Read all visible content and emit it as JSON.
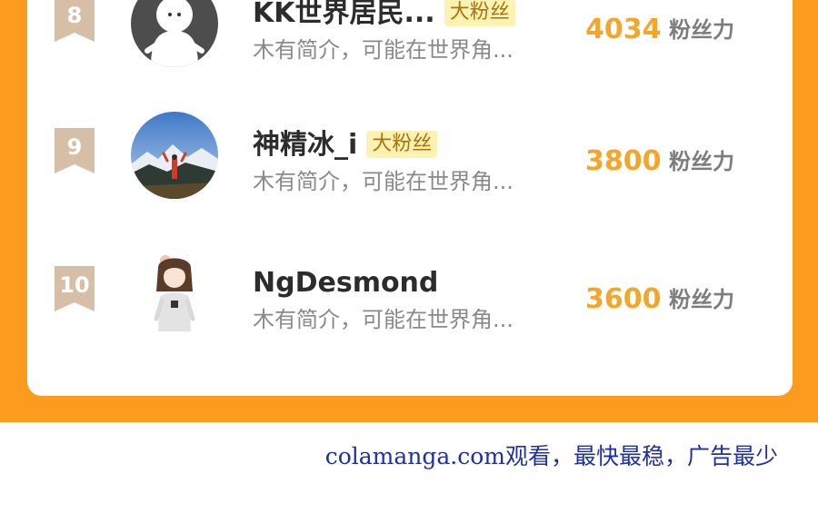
{
  "leaderboard": {
    "rows": [
      {
        "rank": "8",
        "name": "KK世界居民...",
        "badge": "大粉丝",
        "bio": "木有简介，可能在世界角...",
        "score": "4034",
        "unit": "粉丝力"
      },
      {
        "rank": "9",
        "name": "神精冰_i",
        "badge": "大粉丝",
        "bio": "木有简介，可能在世界角...",
        "score": "3800",
        "unit": "粉丝力"
      },
      {
        "rank": "10",
        "name": "NgDesmond",
        "badge": "",
        "bio": "木有简介，可能在世界角...",
        "score": "3600",
        "unit": "粉丝力"
      }
    ]
  },
  "footer": {
    "text": "colamanga.com观看，最快最稳，广告最少"
  },
  "colors": {
    "orange_bg": "#fb9c1f",
    "score": "#f2a62a",
    "rank_ribbon": "#d6bfa6",
    "badge_bg": "#fdf2b2",
    "footer_text": "#1f2fa8"
  },
  "icons": {
    "rank": "ribbon-badge",
    "avatar_8": "ghost-figure",
    "avatar_9": "mountain-photo",
    "avatar_10": "anime-girl"
  }
}
